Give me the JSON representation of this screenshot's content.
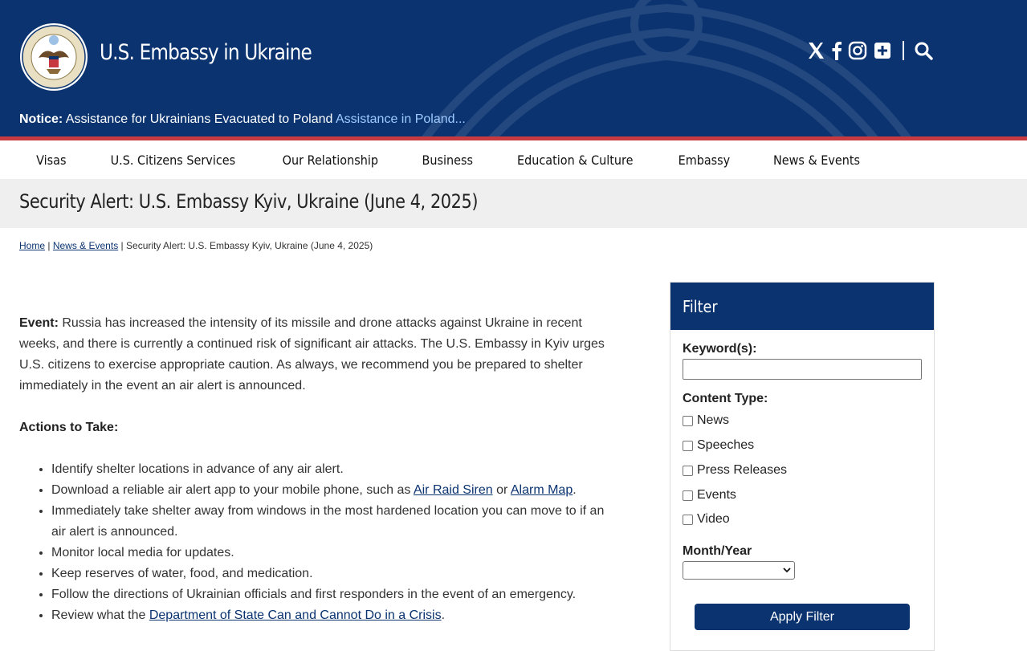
{
  "header": {
    "site_title": "U.S. Embassy in Ukraine",
    "notice_label": "Notice:",
    "notice_text": "Assistance for Ukrainians Evacuated to Poland",
    "notice_link": "Assistance in Poland...",
    "social_icons": [
      "x-icon",
      "facebook-icon",
      "instagram-icon",
      "plus-square-icon",
      "search-icon"
    ]
  },
  "nav": {
    "items": [
      "Visas",
      "U.S. Citizens Services",
      "Our Relationship",
      "Business",
      "Education & Culture",
      "Embassy",
      "News & Events"
    ]
  },
  "page": {
    "title": "Security Alert: U.S. Embassy Kyiv, Ukraine (June 4, 2025)"
  },
  "breadcrumb": {
    "home": "Home",
    "sep": "|",
    "section": "News & Events",
    "current": "Security Alert: U.S. Embassy Kyiv, Ukraine (June 4, 2025)"
  },
  "article": {
    "event_label": "Event:",
    "event_text": " Russia has increased the intensity of its missile and drone attacks against Ukraine in recent weeks, and there is currently a continued risk of significant air attacks. The U.S. Embassy in Kyiv urges U.S. citizens to exercise appropriate caution.  As always, we recommend you be prepared to shelter immediately in the event an air alert is announced.",
    "actions_heading": "Actions to Take:",
    "bullet1": "Identify shelter locations in advance of any air alert.",
    "bullet2_pre": "Download a reliable air alert app to your mobile phone, such as ",
    "bullet2_link1": "Air Raid Siren",
    "bullet2_mid": " or ",
    "bullet2_link2": "Alarm Map",
    "bullet2_post": ".",
    "bullet3": "Immediately take shelter away from windows in the most hardened location you can move to if an air alert is announced.",
    "bullet4": "Monitor local media for updates.",
    "bullet5": "Keep reserves of water, food, and medication.",
    "bullet6": "Follow the directions of Ukrainian officials and first responders in the event of an emergency.",
    "bullet7_pre": "Review what the ",
    "bullet7_link": "Department of State Can and Cannot Do in a Crisis",
    "bullet7_post": "."
  },
  "filter": {
    "title": "Filter",
    "keyword_label": "Keyword(s):",
    "keyword_value": "",
    "content_type_label": "Content Type:",
    "options": [
      "News",
      "Speeches",
      "Press Releases",
      "Events",
      "Video"
    ],
    "month_year_label": "Month/Year",
    "month_year_value": "",
    "apply_label": "Apply Filter"
  },
  "colors": {
    "brand_navy": "#0a3370",
    "accent_red": "#c73a3f",
    "link_light": "#9ecbff"
  }
}
